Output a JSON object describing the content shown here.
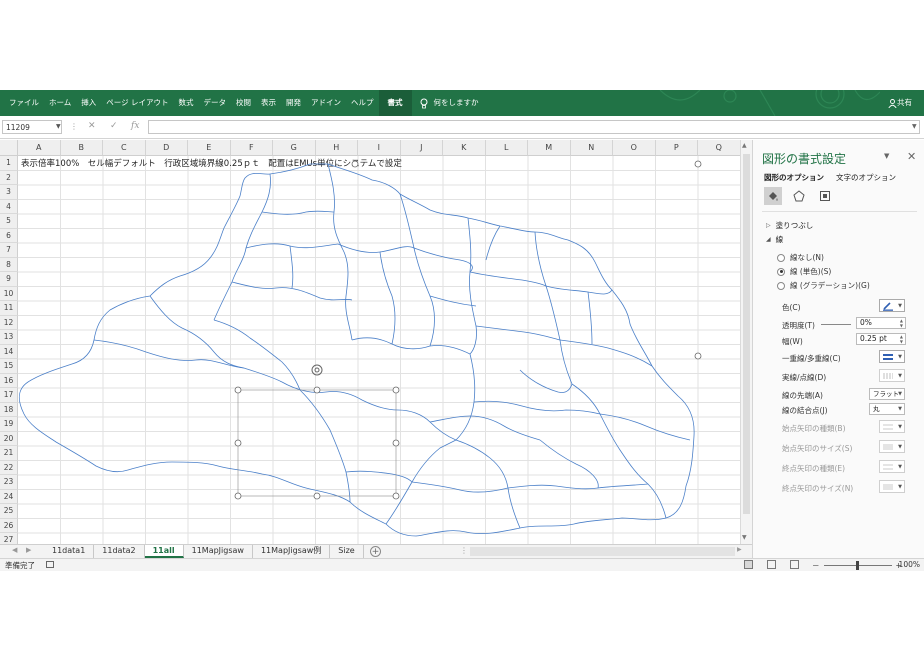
{
  "ribbon": {
    "tabs": [
      "ファイル",
      "ホーム",
      "挿入",
      "ページ レイアウト",
      "数式",
      "データ",
      "校閲",
      "表示",
      "開発",
      "アドイン",
      "ヘルプ",
      "書式"
    ],
    "active_tab": "書式",
    "tell_me": "何をしますか",
    "share": "共有"
  },
  "formula_bar": {
    "name_box": "11209",
    "fx_label": "fx",
    "formula": ""
  },
  "sheet": {
    "columns": [
      "A",
      "B",
      "C",
      "D",
      "E",
      "F",
      "G",
      "H",
      "I",
      "J",
      "K",
      "L",
      "M",
      "N",
      "O",
      "P",
      "Q"
    ],
    "rows": [
      "1",
      "2",
      "3",
      "4",
      "5",
      "6",
      "7",
      "8",
      "9",
      "10",
      "11",
      "12",
      "13",
      "14",
      "15",
      "16",
      "17",
      "18",
      "19",
      "20",
      "21",
      "22",
      "23",
      "24",
      "25",
      "26",
      "27"
    ],
    "a1_text": "表示倍率100%　セル幅デフォルト　行政区域境界線0.25ｐｔ　配置はEMUs単位にシステムで設定",
    "map_stroke_color": "#4a7fc8"
  },
  "sheet_tabs": {
    "tabs": [
      "11data1",
      "11data2",
      "11all",
      "11MapJigsaw",
      "11MapJigsaw例",
      "Size"
    ],
    "active": "11all"
  },
  "status_bar": {
    "ready": "準備完了",
    "zoom": "100%",
    "zoom_minus": "－",
    "zoom_plus": "+"
  },
  "format_pane": {
    "title": "図形の書式設定",
    "tabs": [
      "図形のオプション",
      "文字のオプション"
    ],
    "sections": {
      "fill": "塗りつぶし",
      "line": "線"
    },
    "line_options": [
      {
        "label": "線なし(N)",
        "selected": false
      },
      {
        "label": "線 (単色)(S)",
        "selected": true
      },
      {
        "label": "線 (グラデーション)(G)",
        "selected": false
      }
    ],
    "props": {
      "color": "色(C)",
      "transparency": "透明度(T)",
      "transparency_value": "0%",
      "width": "幅(W)",
      "width_value": "0.25 pt",
      "compound": "一重線/多重線(C)",
      "dash": "実線/点線(D)",
      "cap": "線の先端(A)",
      "cap_value": "フラット",
      "join": "線の結合点(J)",
      "join_value": "丸",
      "begin_arrow_type": "始点矢印の種類(B)",
      "begin_arrow_size": "始点矢印のサイズ(S)",
      "end_arrow_type": "終点矢印の種類(E)",
      "end_arrow_size": "終点矢印のサイズ(N)"
    },
    "accent_color": "#217346"
  }
}
